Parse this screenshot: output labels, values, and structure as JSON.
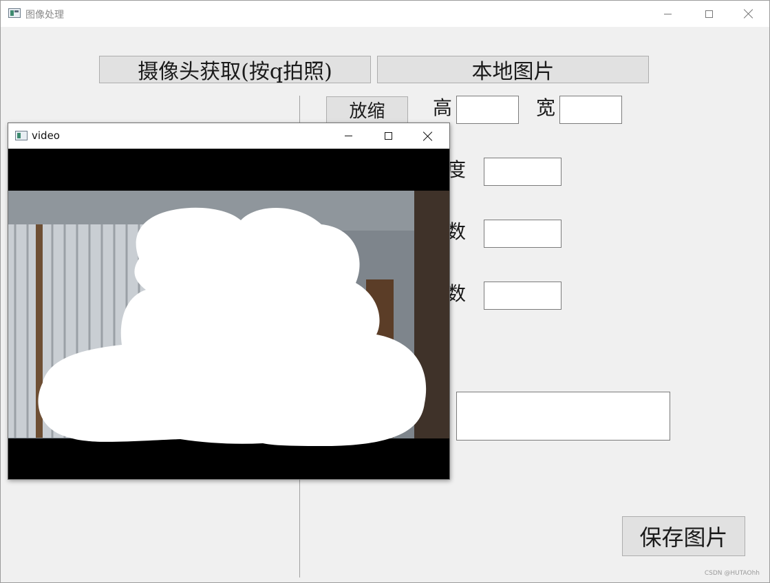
{
  "window": {
    "title": "图像处理"
  },
  "buttons": {
    "camera": "摄像头获取(按q拍照)",
    "local_image": "本地图片",
    "zoom": "放缩",
    "save": "保存图片"
  },
  "labels": {
    "height": "高",
    "width": "宽",
    "partial_1": "度",
    "partial_2": "数",
    "partial_3": "数"
  },
  "video_window": {
    "title": "video"
  },
  "watermark": "CSDN @HUTAOhh",
  "colors": {
    "window_bg": "#f0f0f0",
    "button_bg": "#e1e1e1",
    "video_bg": "#000000"
  }
}
